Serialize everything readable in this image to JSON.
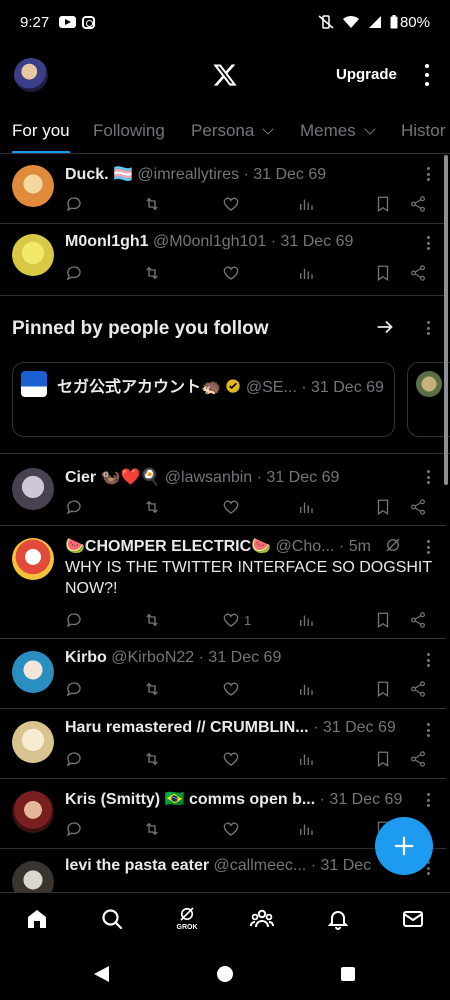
{
  "status_bar": {
    "time": "9:27",
    "battery": "80%"
  },
  "header": {
    "upgrade_label": "Upgrade"
  },
  "tabs": [
    {
      "label": "For you",
      "active": true
    },
    {
      "label": "Following"
    },
    {
      "label": "Persona"
    },
    {
      "label": "Memes"
    },
    {
      "label": "Histor"
    }
  ],
  "posts": [
    {
      "name": "Duck. 🏳️‍⚧️",
      "handle": "@imreallytires",
      "time": "· 31 Dec 69"
    },
    {
      "name": "M0onl1gh1",
      "handle": "@M0onl1gh101",
      "time": "· 31 Dec 69"
    }
  ],
  "pinned": {
    "title": "Pinned by people you follow",
    "card": {
      "name": "セガ公式アカウント🦔",
      "handle": "@SE...",
      "time": "· 31 Dec 69"
    }
  },
  "posts2": [
    {
      "name": "Cier 🦦❤️🍳",
      "handle": "@lawsanbin",
      "time": "· 31 Dec 69"
    },
    {
      "name": "🍉CHOMPER ELECTRIC🍉",
      "handle": "@Cho...",
      "time": "· 5m",
      "text": "WHY IS THE TWITTER INTERFACE SO DOGSHIT NOW?!",
      "likes": "1"
    },
    {
      "name": "Kirbo",
      "handle": "@KirboN22",
      "time": "· 31 Dec 69"
    },
    {
      "name": "Haru remastered // CRUMBLIN...",
      "handle": "",
      "time": "· 31 Dec 69"
    },
    {
      "name": "Kris (Smitty) 🇧🇷 comms open b...",
      "handle": "",
      "time": "· 31 Dec 69"
    },
    {
      "name": "levi the pasta eater",
      "handle": "@callmeec...",
      "time": "· 31 Dec"
    }
  ],
  "bottom_nav": {
    "grok_label": "GROK"
  },
  "colors": {
    "accent": "#1d9bf0",
    "muted": "#71767b",
    "divider": "#2f3336"
  }
}
